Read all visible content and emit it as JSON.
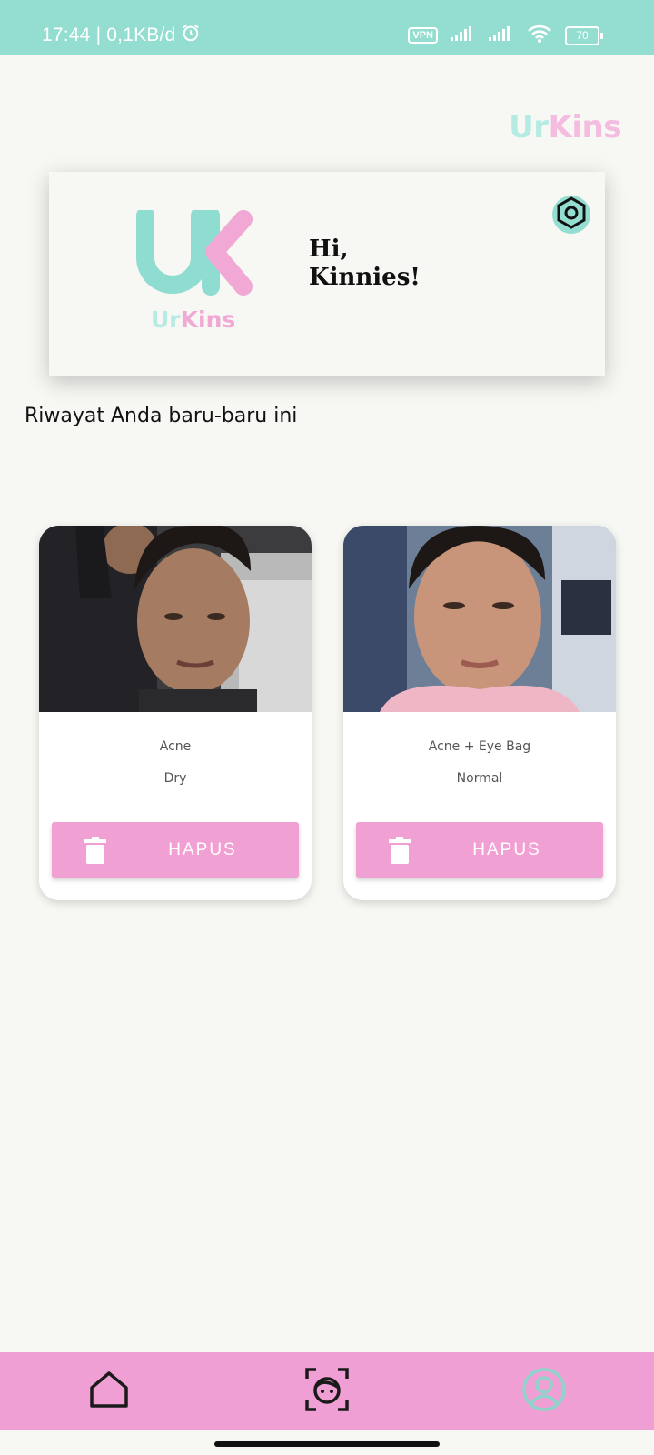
{
  "status_bar": {
    "time_speed": "17:44 | 0,1KB/d",
    "vpn_label": "VPN",
    "battery_level": "70"
  },
  "brand": {
    "ur": "Ur",
    "kins": "Kins"
  },
  "hero": {
    "logo_ur": "Ur",
    "logo_kins": "Kins",
    "greeting_line1": "Hi,",
    "greeting_line2": "Kinnies!"
  },
  "history": {
    "title": "Riwayat Anda baru-baru ini",
    "items": [
      {
        "condition": "Acne",
        "skin_type": "Dry",
        "delete_label": "HAPUS"
      },
      {
        "condition": "Acne + Eye Bag",
        "skin_type": "Normal",
        "delete_label": "HAPUS"
      }
    ]
  },
  "colors": {
    "accent_teal": "#93ddd1",
    "accent_pink": "#f1a0d3",
    "background": "#f7f7f3"
  },
  "nav": {
    "items": [
      {
        "icon": "home-icon"
      },
      {
        "icon": "face-scan-icon"
      },
      {
        "icon": "profile-icon"
      }
    ]
  }
}
